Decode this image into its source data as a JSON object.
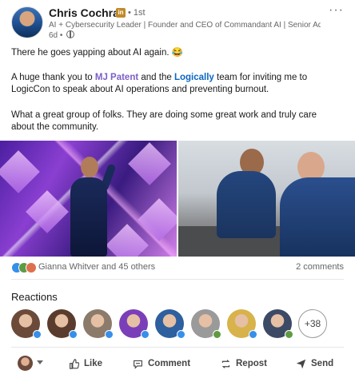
{
  "post": {
    "author": "Chris Cochran",
    "linkedin_badge": "in",
    "degree": "• 1st",
    "headline": "AI + Cybersecurity Leader | Founder and CEO of Commandant AI | Senior Advi...",
    "time": "6d •",
    "more": "···",
    "text1": "There he goes yapping about AI again. 😂",
    "text2_a": "A huge thank you to ",
    "mention1": "MJ Patent",
    "text2_b": " and the ",
    "mention2": "Logically",
    "text2_c": " team for inviting me to LogicCon to speak about AI operations and preventing burnout.",
    "text3": "What a great group of folks. They are doing some great work and truly care about the community."
  },
  "social": {
    "reactors_text": "Gianna Whitver and 45 others",
    "comments_text": "2 comments",
    "reaction_colors": [
      "#378fe9",
      "#5f9b41",
      "#df704d"
    ]
  },
  "reactions_section": {
    "title": "Reactions",
    "more_count": "+38",
    "avatars": [
      {
        "bg": "#6b4a3a",
        "badge": "#378fe9"
      },
      {
        "bg": "#5a3c2e",
        "badge": "#378fe9"
      },
      {
        "bg": "#8c7a6a",
        "badge": "#378fe9"
      },
      {
        "bg": "#7a3fb8",
        "badge": "#378fe9"
      },
      {
        "bg": "#2e5f9e",
        "badge": "#378fe9"
      },
      {
        "bg": "#9a9a9a",
        "badge": "#5f9b41"
      },
      {
        "bg": "#d8b24a",
        "badge": "#378fe9"
      },
      {
        "bg": "#3c4a66",
        "badge": "#5f9b41"
      }
    ]
  },
  "actions": {
    "like": "Like",
    "comment": "Comment",
    "repost": "Repost",
    "send": "Send"
  }
}
